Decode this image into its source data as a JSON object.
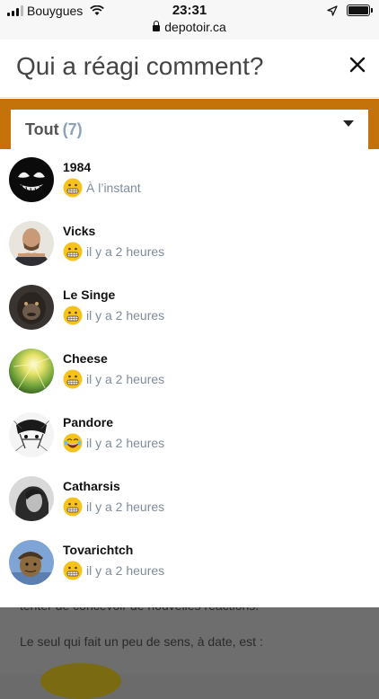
{
  "status_bar": {
    "carrier": "Bouygues",
    "time": "23:31",
    "url": "depotoir.ca"
  },
  "modal": {
    "title": "Qui a réagi comment?",
    "filter": {
      "label": "Tout",
      "count": "(7)"
    },
    "reactors": [
      {
        "name": "1984",
        "time": "À l’instant",
        "reaction": "grimace-emoji",
        "avatar": "venom-avatar"
      },
      {
        "name": "Vicks",
        "time": "il y a 2 heures",
        "reaction": "grimace-emoji",
        "avatar": "man-avatar"
      },
      {
        "name": "Le Singe",
        "time": "il y a 2 heures",
        "reaction": "grimace-emoji",
        "avatar": "ape-avatar"
      },
      {
        "name": "Cheese",
        "time": "il y a 2 heures",
        "reaction": "grimace-emoji",
        "avatar": "sunlight-avatar"
      },
      {
        "name": "Pandore",
        "time": "il y a 2 heures",
        "reaction": "laughing-emoji",
        "avatar": "manga-avatar"
      },
      {
        "name": "Catharsis",
        "time": "il y a 2 heures",
        "reaction": "grimace-emoji",
        "avatar": "woman-avatar"
      },
      {
        "name": "Tovarichtch",
        "time": "il y a 2 heures",
        "reaction": "grimace-emoji",
        "avatar": "character-avatar"
      }
    ]
  },
  "background_page": {
    "line1": "tenter de concevoir de nouvelles réactions.",
    "line2": "Le seul qui fait un peu de sens, à date, est :"
  },
  "colors": {
    "accent": "#c4720a",
    "muted_text": "#7f8c9a",
    "count_text": "#8ca2b8"
  }
}
